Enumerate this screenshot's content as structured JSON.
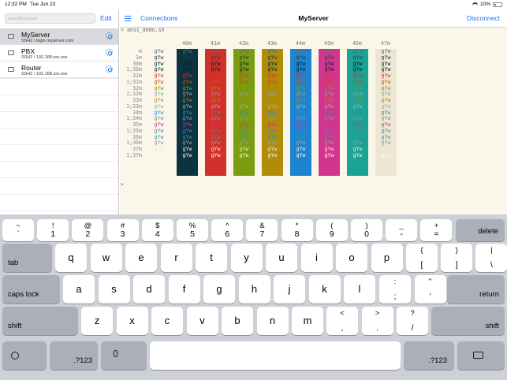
{
  "status_bar": {
    "time": "12:32 PM",
    "date": "Tue Jun 23",
    "wifi_icon": "wifi-icon",
    "battery_percent": "10%",
    "battery_icon": "battery-low-icon"
  },
  "sidebar": {
    "search_placeholder": "user@host:port",
    "edit_label": "Edit",
    "hosts": [
      {
        "name": "MyServer",
        "sub": "SSH2 / login.myserver.com",
        "selected": true
      },
      {
        "name": "PBX",
        "sub": "SSH2 / 192.168.xxx.xxx",
        "selected": false
      },
      {
        "name": "Router",
        "sub": "SSH2 / 192.168.xxx.xxx",
        "selected": false
      }
    ]
  },
  "header": {
    "connections_label": "Connections",
    "title": "MyServer",
    "disconnect_label": "Disconnect"
  },
  "terminal": {
    "command_line": "> ansi_demo.sh",
    "prompt": ">",
    "sample": "gYw",
    "bg_headers": [
      "40m",
      "41m",
      "42m",
      "43m",
      "44m",
      "45m",
      "46m",
      "47m"
    ],
    "bg_colors": [
      "#0b3340",
      "#d2302b",
      "#7a9c0e",
      "#b08c08",
      "#1d84d2",
      "#d2358d",
      "#1aa295",
      "#ede6d2"
    ],
    "row_labels": [
      "m",
      "1m",
      "30m",
      "1;30m",
      "31m",
      "1;31m",
      "32m",
      "1;32m",
      "33m",
      "1;33m",
      "34m",
      "1;34m",
      "35m",
      "1;35m",
      "36m",
      "1;36m",
      "37m",
      "1;37m"
    ],
    "fg_colors": [
      "#586e75",
      "#2b3a40",
      "#00202a",
      "#00202a",
      "#dc322f",
      "#cb4b16",
      "#859900",
      "#93a1a1",
      "#b58900",
      "#9fb3b3",
      "#268bd2",
      "#839496",
      "#d33682",
      "#6c71c4",
      "#2aa198",
      "#93a1a1",
      "#eee8d5",
      "#fdf6e3"
    ]
  },
  "keyboard": {
    "row1": [
      {
        "top": "~",
        "bot": "`"
      },
      {
        "top": "!",
        "bot": "1"
      },
      {
        "top": "@",
        "bot": "2"
      },
      {
        "top": "#",
        "bot": "3"
      },
      {
        "top": "$",
        "bot": "4"
      },
      {
        "top": "%",
        "bot": "5"
      },
      {
        "top": "^",
        "bot": "6"
      },
      {
        "top": "&",
        "bot": "7"
      },
      {
        "top": "*",
        "bot": "8"
      },
      {
        "top": "(",
        "bot": "9"
      },
      {
        "top": ")",
        "bot": "0"
      },
      {
        "top": "_",
        "bot": "-"
      },
      {
        "top": "+",
        "bot": "="
      }
    ],
    "delete": "delete",
    "tab": "tab",
    "row2": [
      "q",
      "w",
      "e",
      "r",
      "t",
      "y",
      "u",
      "i",
      "o",
      "p"
    ],
    "row2_extra": [
      {
        "top": "{",
        "bot": "["
      },
      {
        "top": "}",
        "bot": "]"
      },
      {
        "top": "|",
        "bot": "\\"
      }
    ],
    "caps": "caps lock",
    "row3": [
      "a",
      "s",
      "d",
      "f",
      "g",
      "h",
      "j",
      "k",
      "l"
    ],
    "row3_extra": [
      {
        "top": ":",
        "bot": ";"
      },
      {
        "top": "\"",
        "bot": "'"
      }
    ],
    "return": "return",
    "shift": "shift",
    "row4": [
      "z",
      "x",
      "c",
      "v",
      "b",
      "n",
      "m"
    ],
    "row4_extra": [
      {
        "top": "<",
        "bot": ","
      },
      {
        "top": ">",
        "bot": "."
      },
      {
        "top": "?",
        "bot": "/"
      }
    ],
    "numbers": ".?123",
    "icons": {
      "emoji": "emoji-icon",
      "mic": "microphone-icon",
      "hide": "keyboard-dismiss-icon"
    }
  }
}
